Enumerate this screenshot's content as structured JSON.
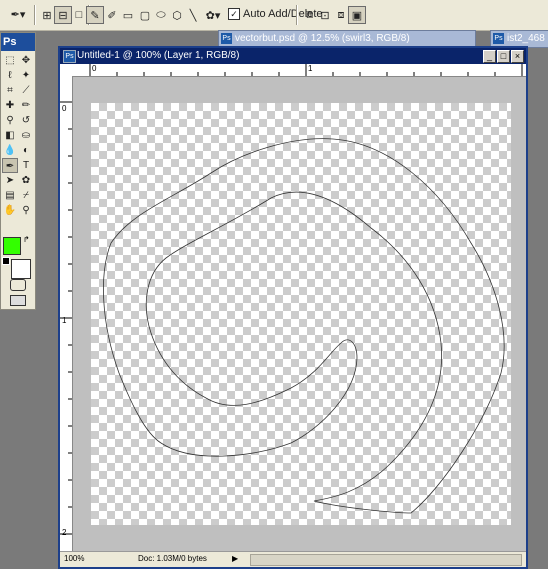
{
  "options_bar": {
    "auto_add_delete_label": "Auto Add/Delete",
    "auto_add_delete_checked": true
  },
  "background_windows": [
    {
      "title": "vectorbut.psd @ 12.5% (swirl3, RGB/8)"
    },
    {
      "title": "ist2_468"
    }
  ],
  "toolbox": {
    "logo": "Ps",
    "foreground_color": "#33ff00",
    "background_color": "#ffffff"
  },
  "document": {
    "title": "Untitled-1 @ 100% (Layer 1, RGB/8)",
    "ruler_top_labels": [
      "0",
      "1"
    ],
    "ruler_left_labels": [
      "0",
      "1",
      "2"
    ],
    "status_zoom": "100%",
    "status_doc": "Doc: 1.03M/0 bytes"
  },
  "colors": {
    "title_bar_active": "#0a246a",
    "ui_face": "#ece9d8",
    "workspace": "#7a7a7a"
  }
}
